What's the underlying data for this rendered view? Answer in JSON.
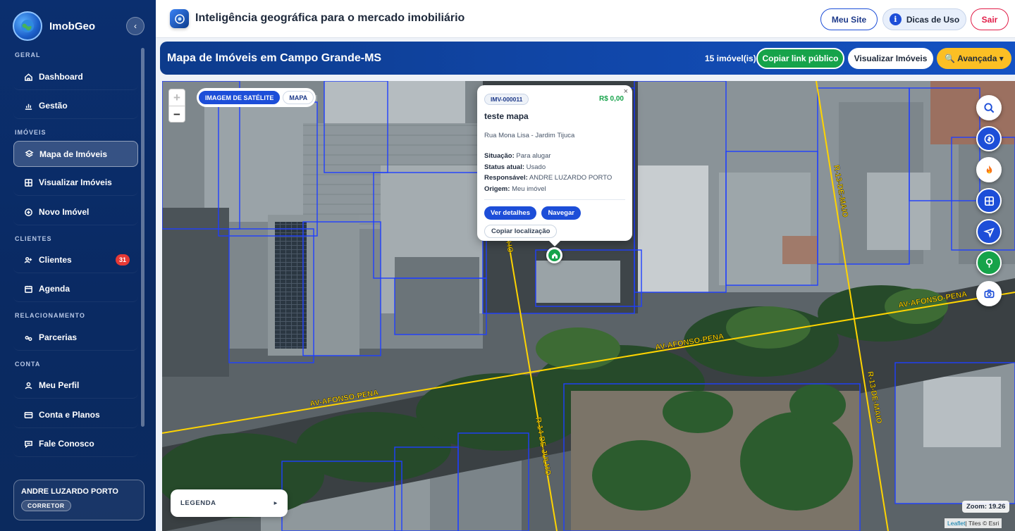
{
  "brand": {
    "name": "ImobGeo"
  },
  "sidebar": {
    "sections": {
      "geral": "GERAL",
      "imoveis": "IMÓVEIS",
      "clientes": "CLIENTES",
      "relacionamento": "RELACIONAMENTO",
      "conta": "CONTA"
    },
    "items": [
      {
        "label": "Dashboard",
        "icon": "home-icon"
      },
      {
        "label": "Gestão",
        "icon": "chart-icon"
      },
      {
        "label": "Mapa de Imóveis",
        "icon": "layers-icon",
        "active": true
      },
      {
        "label": "Visualizar Imóveis",
        "icon": "grid-icon"
      },
      {
        "label": "Novo Imóvel",
        "icon": "plus-circle-icon"
      },
      {
        "label": "Clientes",
        "icon": "users-icon",
        "badge": "31"
      },
      {
        "label": "Agenda",
        "icon": "calendar-icon"
      },
      {
        "label": "Parcerias",
        "icon": "link-icon"
      },
      {
        "label": "Meu Perfil",
        "icon": "user-icon"
      },
      {
        "label": "Conta e Planos",
        "icon": "card-icon"
      },
      {
        "label": "Fale Conosco",
        "icon": "chat-icon"
      }
    ],
    "user": {
      "name": "ANDRE LUZARDO PORTO",
      "role": "CORRETOR"
    }
  },
  "topbar": {
    "title": "Inteligência geográfica para o mercado imobiliário",
    "my_site": "Meu Site",
    "tips": "Dicas de Uso",
    "tips_icon": "i",
    "exit": "Sair"
  },
  "page_header": {
    "title": "Mapa de Imóveis em Campo Grande-MS",
    "count": "15 imóvel(is)",
    "copy_link": "Copiar link público",
    "view_properties": "Visualizar Imóveis",
    "advanced": "🔍 Avançada ▾"
  },
  "map": {
    "zoom_in": "+",
    "zoom_out": "−",
    "layers": {
      "satellite": "IMAGEM DE SATÉLITE",
      "map": "MAPA"
    },
    "streets": [
      "AV-AFONSO-PENA",
      "AV-AFONSO-PENA",
      "AV-AFONSO-PENA",
      "R-14-DE-JULHO",
      "R-13-DE-MAIO",
      "R-13-DE-MAIO",
      "HO"
    ],
    "popup": {
      "close": "×",
      "code": "IMV-000011",
      "price": "R$ 0,00",
      "title": "teste mapa",
      "address": "Rua Mona Lisa - Jardim Tijuca",
      "rows": [
        {
          "label": "Situação:",
          "value": "Para alugar"
        },
        {
          "label": "Status atual:",
          "value": "Usado"
        },
        {
          "label": "Responsável:",
          "value": "ANDRE LUZARDO PORTO"
        },
        {
          "label": "Origem:",
          "value": "Meu imóvel"
        }
      ],
      "details_btn": "Ver detalhes",
      "navigate_btn": "Navegar",
      "copy_location_btn": "Copiar localização"
    },
    "marker_icon": "house-icon",
    "legend": {
      "label": "LEGENDA",
      "arrow": "▸"
    },
    "zoom_level": "Zoom: 19.26",
    "attribution": {
      "leaflet": "Leaflet",
      "rest": " | Tiles © Esri"
    },
    "fab_colors": [
      "#ffffff",
      "#1d4ed8",
      "#ffffff",
      "#1d4ed8",
      "#1d4ed8",
      "#16a34a",
      "#ffffff"
    ]
  }
}
